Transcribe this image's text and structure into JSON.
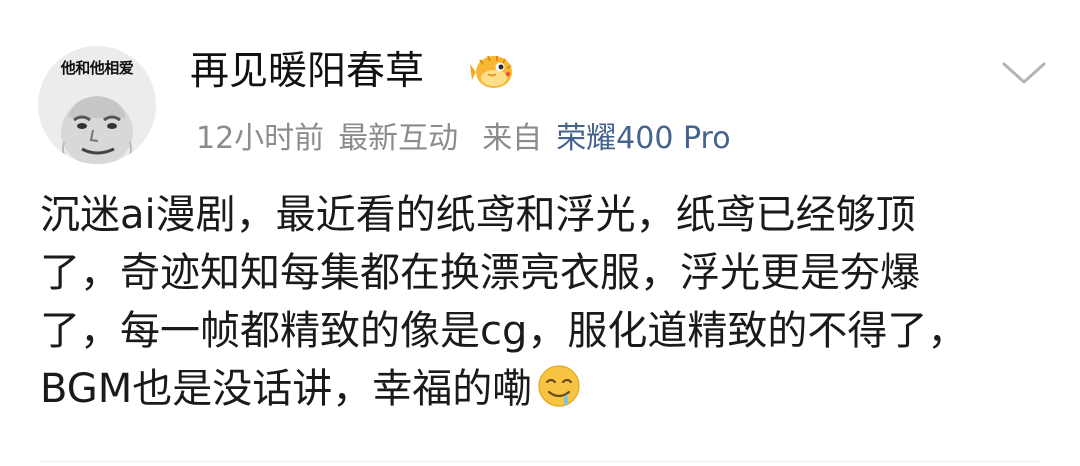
{
  "post": {
    "author": {
      "name": "再见暖阳春草",
      "avatar_caption": "他和他相爱",
      "badge_icon": "pufferfish-member-badge-icon"
    },
    "meta": {
      "time": "12小时前",
      "activity": "最新互动",
      "source_prefix": "来自",
      "device": "荣耀400 Pro"
    },
    "menu_icon": "chevron-down-icon",
    "text_lines": [
      "沉迷ai漫剧，最近看的纸鸢和浮光，纸鸢已经够顶",
      "了，奇迹知知每集都在换漂亮衣服，浮光更是夯爆",
      "了，每一帧都精致的像是cg，服化道精致的不得了，",
      "BGM也是没话讲，幸福的嘞"
    ],
    "trailing_emoji_icon": "drooling-face-emoji-icon"
  },
  "colors": {
    "meta_gray": "#8c8c8c",
    "device_blue": "#45638f",
    "text": "#1a1a1a",
    "badge_orange": "#f5a623"
  }
}
